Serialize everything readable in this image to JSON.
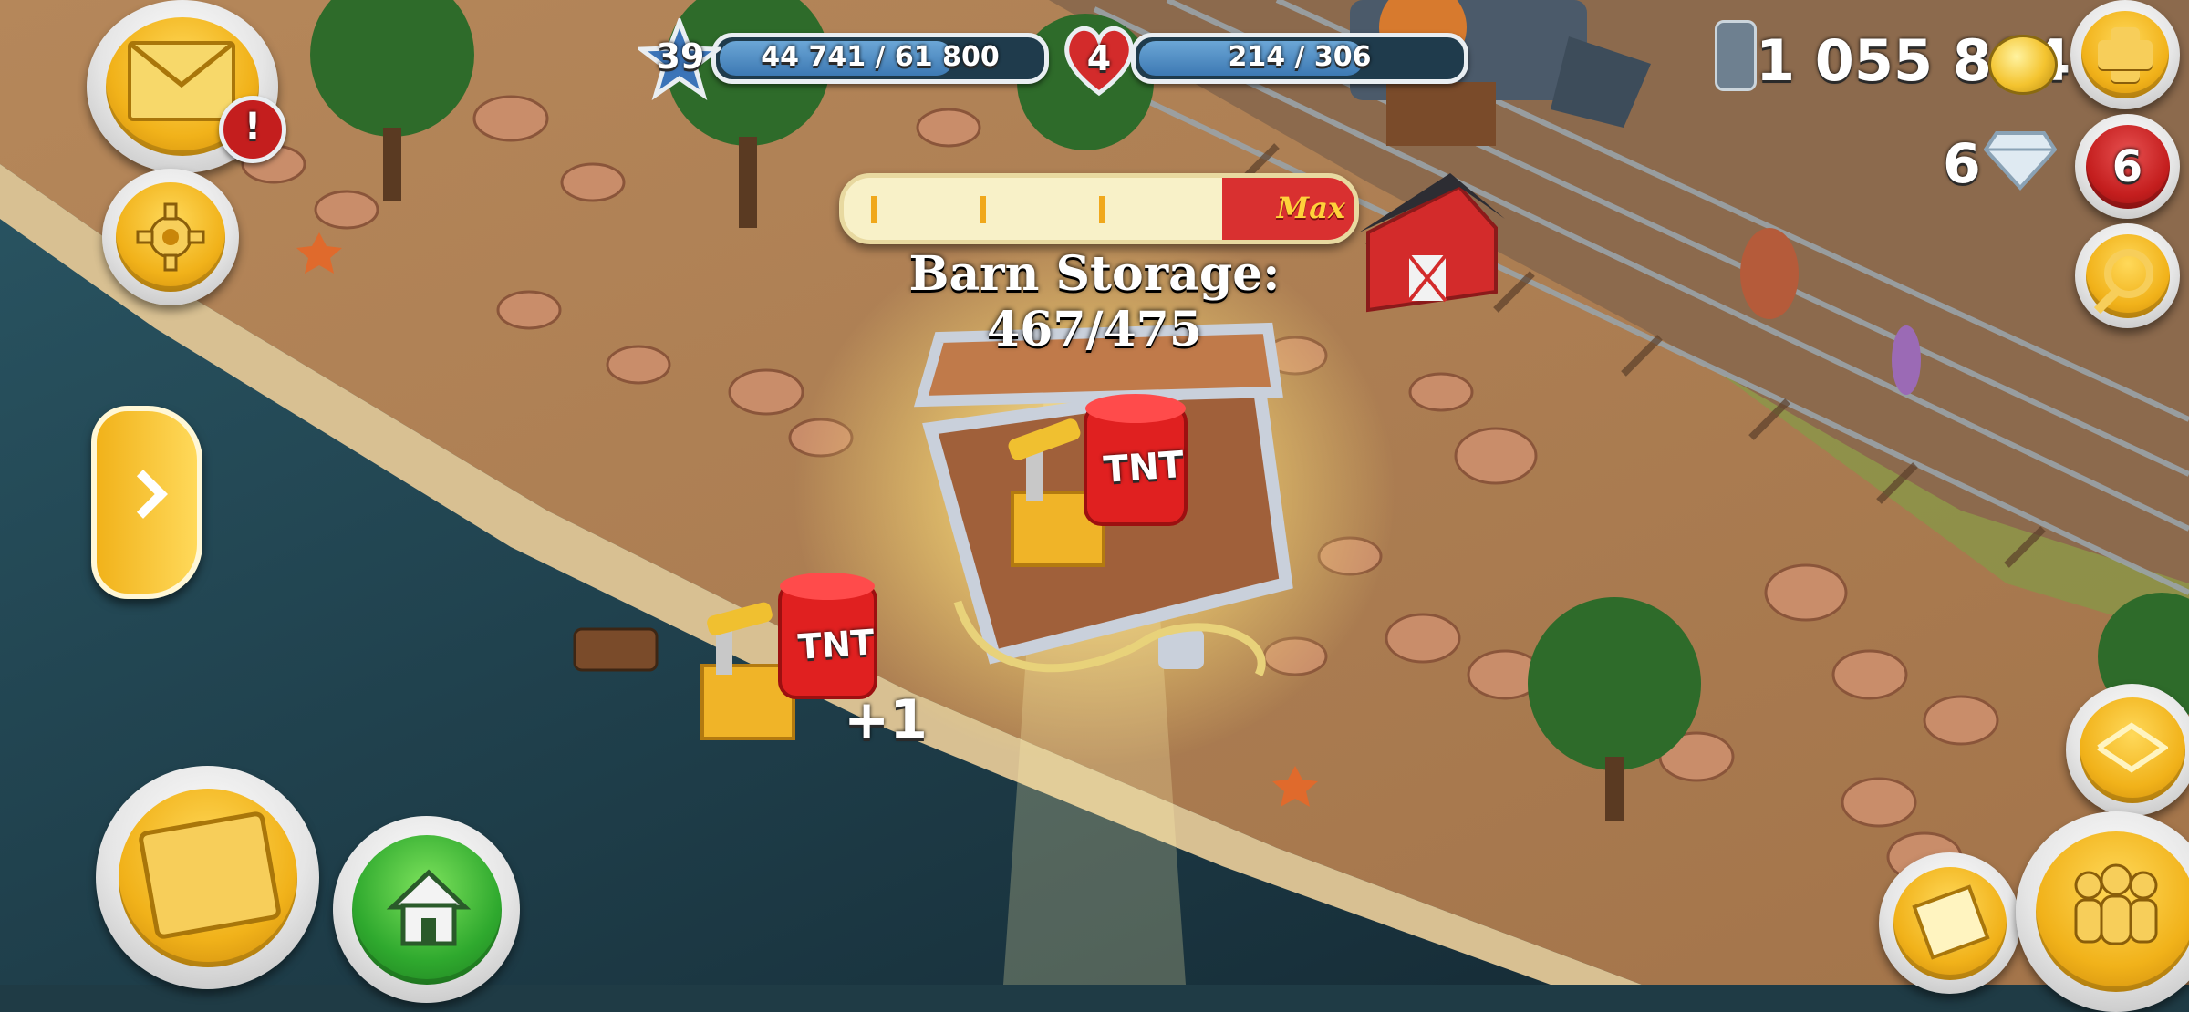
{
  "hud": {
    "level": "39",
    "xp_text": "44 741 / 61 800",
    "xp_progress": 0.724,
    "hearts": "4",
    "rep_text": "214 / 306",
    "rep_progress": 0.699,
    "coins": "1 055 864",
    "diamonds": "6",
    "diamond_badge": "6",
    "mail_alert": "!"
  },
  "popup": {
    "storage_label": "Barn Storage: 467/475",
    "storage_progress": 0.983,
    "bar_tag": "Max",
    "reward_plus": "+1",
    "tnt_label": "TNT"
  },
  "colors": {
    "gold": "#f1b21a",
    "ocean": "#1f3b45",
    "sand": "#c9a67a",
    "grass": "#6a9a3a",
    "barn_red": "#d32b2b"
  }
}
